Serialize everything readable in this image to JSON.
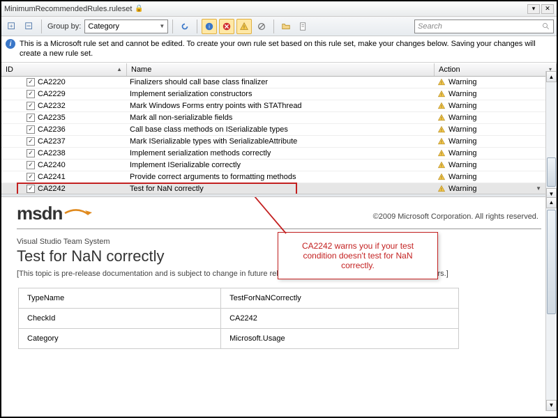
{
  "title": "MinimumRecommendedRules.ruleset",
  "toolbar": {
    "groupby_label": "Group by:",
    "groupby_value": "Category",
    "search_placeholder": "Search"
  },
  "info_text": "This is a Microsoft rule set and cannot be edited. To create your own rule set based on this rule set, make your changes below. Saving your changes will create a new rule set.",
  "columns": {
    "id": "ID",
    "name": "Name",
    "action": "Action"
  },
  "action_label": "Warning",
  "rules": [
    {
      "id": "CA2220",
      "name": "Finalizers should call base class finalizer"
    },
    {
      "id": "CA2229",
      "name": "Implement serialization constructors"
    },
    {
      "id": "CA2232",
      "name": "Mark Windows Forms entry points with STAThread"
    },
    {
      "id": "CA2235",
      "name": "Mark all non-serializable fields"
    },
    {
      "id": "CA2236",
      "name": "Call base class methods on ISerializable types"
    },
    {
      "id": "CA2237",
      "name": "Mark ISerializable types with SerializableAttribute"
    },
    {
      "id": "CA2238",
      "name": "Implement serialization methods correctly"
    },
    {
      "id": "CA2240",
      "name": "Implement ISerializable correctly"
    },
    {
      "id": "CA2241",
      "name": "Provide correct arguments to formatting methods"
    },
    {
      "id": "CA2242",
      "name": "Test for NaN correctly"
    }
  ],
  "selected_index": 9,
  "doc": {
    "logo": "msdn",
    "copyright": "©2009 Microsoft Corporation. All rights reserved.",
    "breadcrumb": "Visual Studio Team System",
    "title": "Test for NaN correctly",
    "note": "[This topic is pre-release documentation and is subject to change in future releases. Blank topics are included as placeholders.]",
    "props": [
      {
        "k": "TypeName",
        "v": "TestForNaNCorrectly"
      },
      {
        "k": "CheckId",
        "v": "CA2242"
      },
      {
        "k": "Category",
        "v": "Microsoft.Usage"
      }
    ]
  },
  "callout": "CA2242 warns you if your test condition doesn't test for NaN correctly."
}
